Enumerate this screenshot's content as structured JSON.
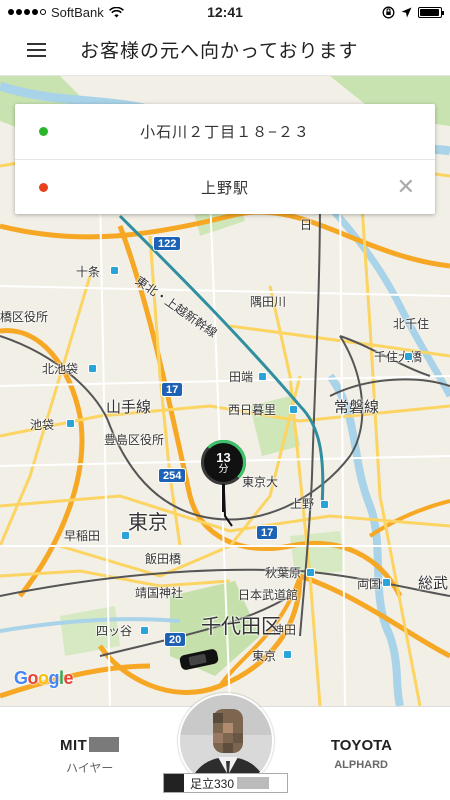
{
  "status_bar": {
    "carrier": "SoftBank",
    "time": "12:41",
    "signal_bars": 4,
    "battery_level": 0.95
  },
  "header": {
    "title": "お客様の元へ向かっております"
  },
  "route": {
    "pickup": "小石川２丁目１８−２３",
    "pickup_color": "#2bb52b",
    "destination": "上野駅",
    "destination_color": "#e8401c"
  },
  "eta": {
    "value": "13",
    "unit": "分"
  },
  "map_labels": {
    "juso": "十条",
    "itabashi": "橋区役所",
    "kitaikebukuro": "北池袋",
    "ikebukuro": "池袋",
    "toshima": "豊島区役所",
    "yamanote": "山手線",
    "tohoku": "東北・上越新幹線",
    "tabata": "田端",
    "nishinippori": "西日暮里",
    "joban": "常磐線",
    "sumidagawa": "隅田川",
    "kitasenju": "北千住",
    "senjuohashi": "千住大橋",
    "todai": "東京大",
    "ueno": "上野",
    "tokyo": "東京",
    "waseda": "早稲田",
    "iidabashi": "飯田橋",
    "yasukuni": "靖国神社",
    "budokan": "日本武道館",
    "akihabara": "秋葉原",
    "kanda": "神田",
    "ryogoku": "両国",
    "sobu": "総武",
    "yotsuya": "四ッ谷",
    "chiyoda": "千代田区",
    "tokyo_station": "東京",
    "nippori_kanji": "日",
    "route_122": "122",
    "route_17a": "17",
    "route_17b": "17",
    "route_254": "254",
    "route_20": "20",
    "google": "Google"
  },
  "vehicle": {
    "make": "MIT",
    "type": "ハイヤー",
    "brand": "TOYOTA",
    "model": "ALPHARD",
    "plate": "足立330"
  },
  "colors": {
    "map_bg": "#f2efe6",
    "highway": "#f6a723",
    "main_road": "#fbd462",
    "rail": "#555555",
    "water": "#a9d3e8",
    "park": "#c8e3b0",
    "shinkansen": "#2f8fa0"
  }
}
